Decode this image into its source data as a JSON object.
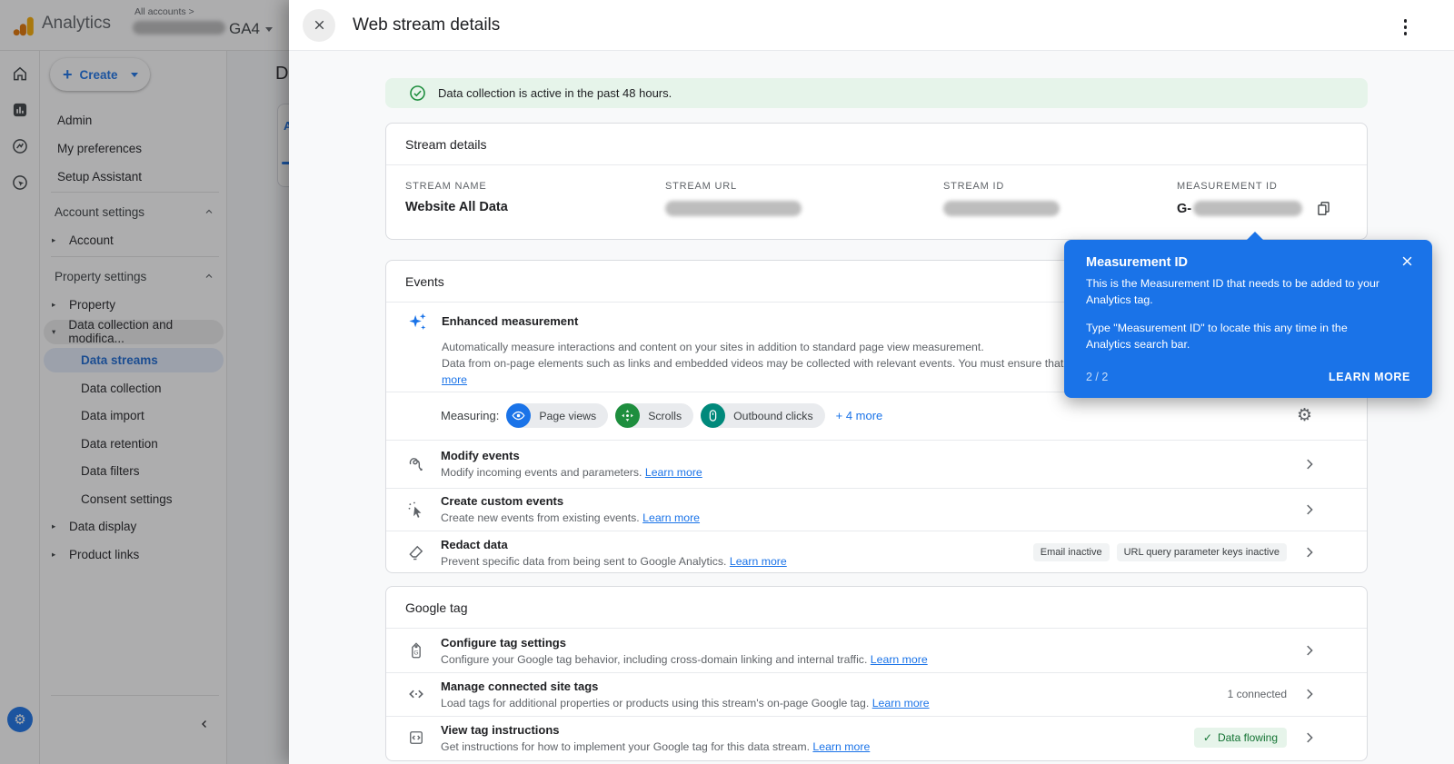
{
  "topbar": {
    "brand": "Analytics",
    "breadcrumb": "All accounts >",
    "property_selector": "GA4"
  },
  "sidebar": {
    "create_label": "Create",
    "menu_items": [
      "Admin",
      "My preferences",
      "Setup Assistant"
    ],
    "account_settings_label": "Account settings",
    "account_item": "Account",
    "property_settings_label": "Property settings",
    "property_item": "Property",
    "collection_group": "Data collection and modifica...",
    "collection_children": [
      "Data streams",
      "Data collection",
      "Data import",
      "Data retention",
      "Data filters",
      "Consent settings"
    ],
    "data_display_item": "Data display",
    "product_links_item": "Product links",
    "selected_item": "Data streams"
  },
  "background_page": {
    "title_fragment": "Da",
    "tab_fragment": "A"
  },
  "panel": {
    "title": "Web stream details",
    "banner_text": "Data collection is active in the past 48 hours.",
    "stream_details": {
      "section_title": "Stream details",
      "name_label": "STREAM NAME",
      "name_value": "Website All Data",
      "url_label": "STREAM URL",
      "id_label": "STREAM ID",
      "measurement_label": "MEASUREMENT ID",
      "measurement_prefix": "G-"
    },
    "events": {
      "section_title": "Events",
      "enhanced_title": "Enhanced measurement",
      "enhanced_desc_1": "Automatically measure interactions and content on your sites in addition to standard page view measurement.",
      "enhanced_desc_2": "Data from on-page elements such as links and embedded videos may be collected with relevant events. You must ensure that no personally-identifiable information will be sent to Google. Learn",
      "enhanced_more_link": "more",
      "measuring_label": "Measuring:",
      "chips": [
        {
          "label": "Page views",
          "color": "#1a73e8"
        },
        {
          "label": "Scrolls",
          "color": "#1e8e3e"
        },
        {
          "label": "Outbound clicks",
          "color": "#00897b"
        }
      ],
      "more_chips": "+ 4 more",
      "rows": [
        {
          "title": "Modify events",
          "desc": "Modify incoming events and parameters.",
          "link": "Learn more"
        },
        {
          "title": "Create custom events",
          "desc": "Create new events from existing events.",
          "link": "Learn more"
        },
        {
          "title": "Redact data",
          "desc": "Prevent specific data from being sent to Google Analytics.",
          "link": "Learn more",
          "badges": [
            "Email inactive",
            "URL query parameter keys inactive"
          ]
        }
      ]
    },
    "google_tag": {
      "section_title": "Google tag",
      "rows": [
        {
          "title": "Configure tag settings",
          "desc": "Configure your Google tag behavior, including cross-domain linking and internal traffic.",
          "link": "Learn more"
        },
        {
          "title": "Manage connected site tags",
          "desc": "Load tags for additional properties or products using this stream's on-page Google tag.",
          "link": "Learn more",
          "meta": "1 connected"
        },
        {
          "title": "View tag instructions",
          "desc": "Get instructions for how to implement your Google tag for this data stream.",
          "link": "Learn more",
          "status": "Data flowing"
        }
      ]
    }
  },
  "tooltip": {
    "title": "Measurement ID",
    "body_1": "This is the Measurement ID that needs to be added to your Analytics tag.",
    "body_2": "Type \"Measurement ID\" to locate this any time in the Analytics search bar.",
    "pagination": "2 / 2",
    "action_label": "LEARN MORE"
  },
  "icons": {
    "settings": "⚙",
    "check": "✓"
  },
  "colors": {
    "accent_blue": "#1a73e8",
    "selected_blue": "#1967d2",
    "chip_pageviews": "#1a73e8",
    "chip_scrolls": "#1e8e3e",
    "chip_outbound": "#00897b",
    "success_green": "#137333",
    "banner_bg": "#e6f4ea",
    "tooltip_bg": "#1a73e8"
  }
}
